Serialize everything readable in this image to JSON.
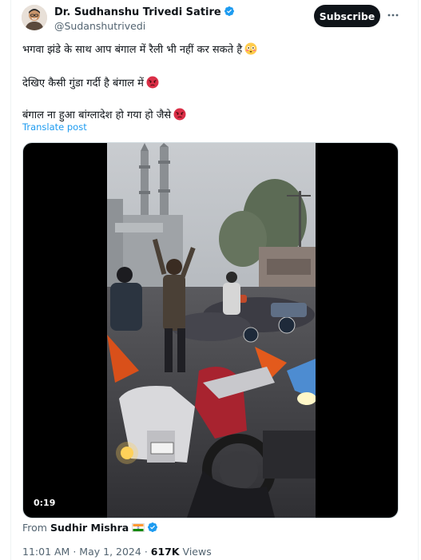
{
  "author": {
    "display_name": "Dr. Sudhanshu Trivedi Satire",
    "handle": "@Sudanshutrivedi",
    "verified": true
  },
  "actions": {
    "subscribe_label": "Subscribe",
    "more_label": "•••"
  },
  "post": {
    "lines": [
      "भगवा झंडे के साथ आप बंगाल में रैली भी नहीं कर सकते है",
      "देखिए कैसी गुंडा गर्दी है बंगाल में",
      "बंगाल ना हुआ बांग्लादेश हो गया हो जैसे"
    ],
    "emojis": [
      "flushed-face-emoji",
      "angry-face-emoji",
      "angry-face-emoji"
    ],
    "translate_label": "Translate post"
  },
  "media": {
    "duration": "0:19"
  },
  "attribution": {
    "prefix": "From",
    "name": "Sudhir Mishra",
    "flag": "india-flag-icon"
  },
  "meta": {
    "time": "11:01 AM",
    "separator": "·",
    "date": "May 1, 2024",
    "views_count": "617K",
    "views_label": "Views"
  },
  "colors": {
    "accent": "#1d9bf0",
    "text": "#0f1419",
    "muted": "#536471",
    "button_bg": "#0f1419"
  }
}
